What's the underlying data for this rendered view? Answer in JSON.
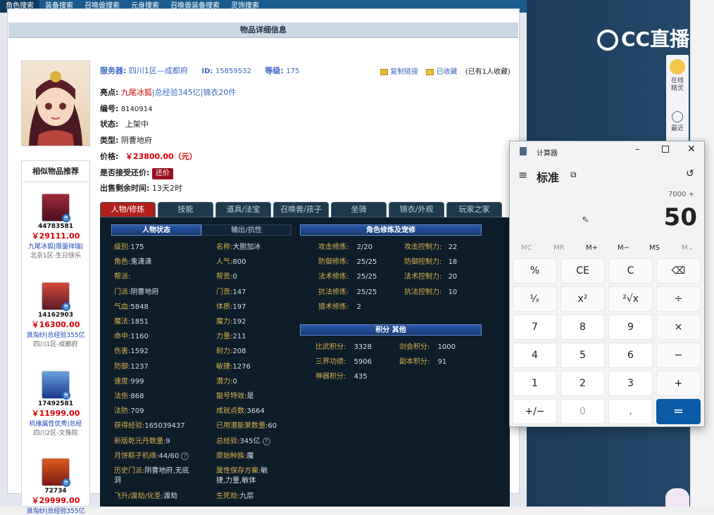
{
  "topnav": [
    "角色搜索",
    "装备搜索",
    "召唤兽搜索",
    "元身搜索",
    "召唤兽装备搜索",
    "灵饰搜索"
  ],
  "page_title": "物品详细信息",
  "header": {
    "server_label": "服务器:",
    "server": "四川1区—成都府",
    "id_label": "ID:",
    "id": "15859532",
    "level_label": "等级:",
    "level": "175",
    "copy_link": "复制链接",
    "favorited": "已收藏",
    "fav_count": "(已有1人收藏)"
  },
  "info": {
    "highlight_label": "亮点:",
    "highlight_1": "九尾冰狐",
    "highlight_2": "总经验345亿",
    "highlight_3": "锦衣20件",
    "code_label": "编号:",
    "code": "8140914",
    "status_label": "状态:",
    "status": "上架中",
    "type_label": "类型:",
    "type": "阴曹地府",
    "price_label": "价格:",
    "price": "￥23800.00（元）",
    "bargain_label": "是否接受还价:",
    "bargain": "还价",
    "time_label": "出售剩余时间:",
    "time": "13天2时"
  },
  "similar": {
    "title": "相似物品推荐",
    "items": [
      {
        "id": "44783581",
        "price": "￥29111.00",
        "desc": "九尾冰狐|限量祥瑞|",
        "server": "北京1区-生日快乐",
        "sell": "售"
      },
      {
        "id": "14162903",
        "price": "￥16300.00",
        "desc": "浪淘纱|总经验355亿",
        "server": "四川1区-成都府",
        "sell": "售"
      },
      {
        "id": "17492581",
        "price": "￥11999.00",
        "desc": "机缘属性优秀|总经",
        "server": "四川2区-文殊院",
        "sell": "售"
      },
      {
        "id": "72734",
        "price": "￥29999.00",
        "desc": "浪淘纱|总经验355亿",
        "server": "",
        "sell": "售"
      }
    ]
  },
  "tabs": [
    "人物/修炼",
    "技能",
    "道具/法宝",
    "召唤兽/孩子",
    "坐骑",
    "锦衣/外观",
    "玩家之家"
  ],
  "panel": {
    "hdr_status": "人物状态",
    "hdr_output": "输出/抗性",
    "hdr_cult": "角色修炼及宠修",
    "hdr_score": "积分 其他",
    "left": [
      {
        "k": "级别:",
        "v": "175"
      },
      {
        "k": "角色:",
        "v": "鬼潇潇"
      },
      {
        "k": "帮派:",
        "v": ""
      },
      {
        "k": "门派:",
        "v": "阴曹地府"
      },
      {
        "k": "气血:",
        "v": "5848"
      },
      {
        "k": "魔法:",
        "v": "1851"
      },
      {
        "k": "命中:",
        "v": "1160"
      },
      {
        "k": "伤害:",
        "v": "1592"
      },
      {
        "k": "防御:",
        "v": "1237"
      },
      {
        "k": "速度:",
        "v": "999"
      },
      {
        "k": "法伤:",
        "v": "868"
      },
      {
        "k": "法防:",
        "v": "709"
      },
      {
        "k": "获得经验:",
        "v": "165039437"
      },
      {
        "k": "新版乾元丹数量:",
        "v": "9"
      },
      {
        "k": "月饼粽子机缘:",
        "v": "44/60"
      }
    ],
    "right": [
      {
        "k": "名称:",
        "v": "大胆加冰"
      },
      {
        "k": "人气:",
        "v": "800"
      },
      {
        "k": "帮贡:",
        "v": "0"
      },
      {
        "k": "门贡:",
        "v": "147"
      },
      {
        "k": "体质:",
        "v": "197"
      },
      {
        "k": "魔力:",
        "v": "192"
      },
      {
        "k": "力量:",
        "v": "211"
      },
      {
        "k": "耐力:",
        "v": "208"
      },
      {
        "k": "敏捷:",
        "v": "1276"
      },
      {
        "k": "潜力:",
        "v": "0"
      },
      {
        "k": "靓号特效:",
        "v": "是"
      },
      {
        "k": "成就点数:",
        "v": "3664"
      },
      {
        "k": "已用潜能果数量:",
        "v": "60"
      },
      {
        "k": "总经验:",
        "v": "345亿"
      },
      {
        "k": "原始种族:",
        "v": "魔"
      }
    ],
    "history_k": "历史门派:",
    "history_v1": "阴曹地府,无底",
    "history_v2": "洞",
    "save_k": "属性保存方案:",
    "save_v1": "敏",
    "save_v2": "捷,力量,敏体",
    "fly_k": "飞升/渡劫/化圣:",
    "fly_v": "渡劫",
    "life_k": "生死劫:",
    "life_v": "九层",
    "cult": [
      {
        "k": "攻击修炼:",
        "v": "2/20",
        "k2": "攻击控制力:",
        "v2": "22"
      },
      {
        "k": "防御修炼:",
        "v": "25/25",
        "k2": "防御控制力:",
        "v2": "18"
      },
      {
        "k": "法术修炼:",
        "v": "25/25",
        "k2": "法术控制力:",
        "v2": "20"
      },
      {
        "k": "抗法修炼:",
        "v": "25/25",
        "k2": "抗法控制力:",
        "v2": "10"
      },
      {
        "k": "猎术修炼:",
        "v": "2",
        "k2": "",
        "v2": ""
      }
    ],
    "score": [
      {
        "k": "比武积分:",
        "v": "3328",
        "k2": "剑会积分:",
        "v2": "1000"
      },
      {
        "k": "三界功绩:",
        "v": "5906",
        "k2": "副本积分:",
        "v2": "91"
      },
      {
        "k": "神器积分:",
        "v": "435",
        "k2": "",
        "v2": ""
      }
    ]
  },
  "overlay": {
    "logo": "CC直播",
    "side_1": "在线",
    "side_2": "精灵",
    "side_3": "最近"
  },
  "calc": {
    "title": "计算器",
    "mode": "标准",
    "expr": "7000 +",
    "display": "50",
    "mem": [
      "MC",
      "MR",
      "M+",
      "M−",
      "MS",
      "M⌄"
    ],
    "keys": [
      "%",
      "CE",
      "C",
      "⌫",
      "¹⁄ₓ",
      "x²",
      "²√x",
      "÷",
      "7",
      "8",
      "9",
      "×",
      "4",
      "5",
      "6",
      "−",
      "1",
      "2",
      "3",
      "+",
      "+/−",
      "0",
      ".",
      "="
    ]
  }
}
